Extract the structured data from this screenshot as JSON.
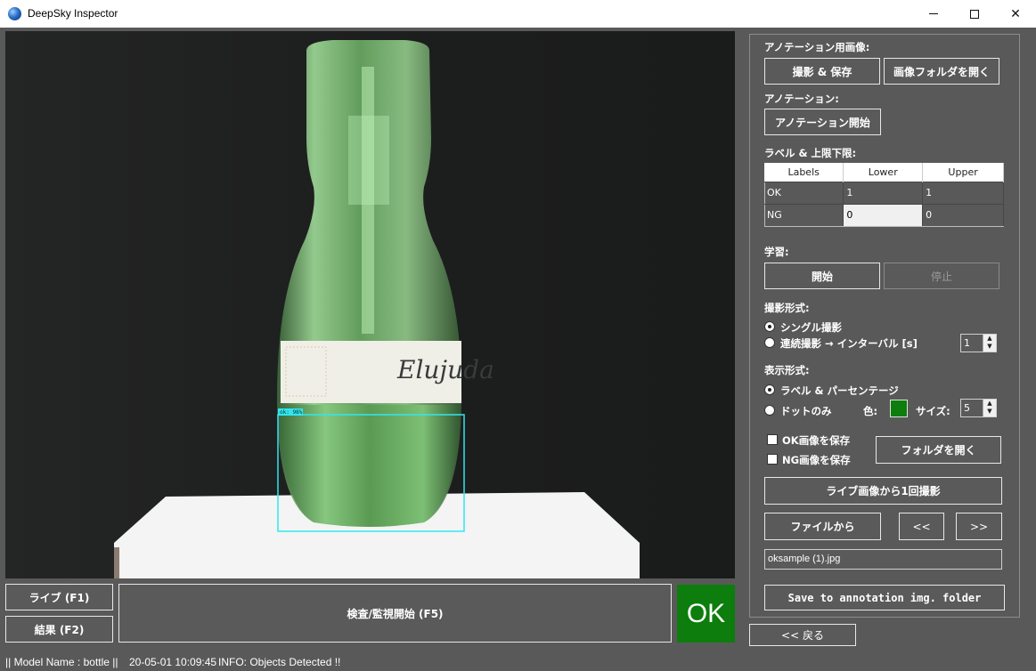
{
  "window": {
    "title": "DeepSky Inspector"
  },
  "viewer": {
    "detection_label": "ok: 98%",
    "bottle_label_text": "Elujuda"
  },
  "bottom": {
    "live_button": "ライブ (F1)",
    "result_button": "結果 (F2)",
    "inspect_button": "検査/監視開始 (F5)",
    "result_status": "OK",
    "back_button": "<< 戻る"
  },
  "panel": {
    "annotation_images_label": "アノテーション用画像:",
    "capture_save_button": "撮影 & 保存",
    "open_image_folder_button": "画像フォルダを開く",
    "annotation_label": "アノテーション:",
    "start_annotation_button": "アノテーション開始",
    "label_limits_label": "ラベル & 上限下限:",
    "table": {
      "headers": [
        "Labels",
        "Lower",
        "Upper"
      ],
      "rows": [
        [
          "OK",
          "1",
          "1"
        ],
        [
          "NG",
          "0",
          "0"
        ]
      ]
    },
    "learning_label": "学習:",
    "start_button": "開始",
    "stop_button": "停止",
    "capture_mode_label": "撮影形式:",
    "single_capture": "シングル撮影",
    "continuous_capture": "連続撮影 → インターバル [s]",
    "interval_value": "1",
    "display_mode_label": "表示形式:",
    "label_percentage": "ラベル & パーセンテージ",
    "dots_only": "ドットのみ",
    "color_label": "色:",
    "size_label": "サイズ:",
    "size_value": "5",
    "save_ok_images": "OK画像を保存",
    "save_ng_images": "NG画像を保存",
    "open_folder_button": "フォルダを開く",
    "capture_once_button": "ライブ画像から1回撮影",
    "from_file_button": "ファイルから",
    "prev_button": "<<",
    "next_button": ">>",
    "file_name": "oksample (1).jpg",
    "save_annotation_button": "Save to annotation img. folder"
  },
  "status": {
    "model": "|| Model Name : bottle ||",
    "timestamp": "20-05-01 10:09:45",
    "info": "INFO:   Objects Detected !!"
  },
  "colors": {
    "accent_ok": "#0d7d0d",
    "detection_box": "#32e6f0",
    "background": "#595959"
  }
}
